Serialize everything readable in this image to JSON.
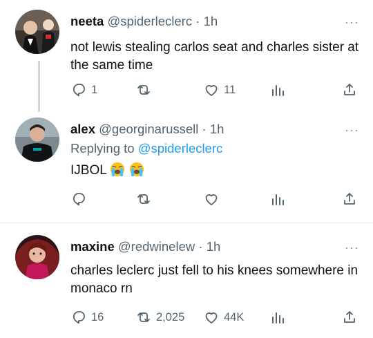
{
  "tweets": [
    {
      "name": "neeta",
      "handle": "@spiderleclerc",
      "separator": "·",
      "time": "1h",
      "more": "···",
      "text": "not lewis stealing carlos seat and charles sister at the same time",
      "reply_count": "1",
      "retweet_count": "",
      "like_count": "11"
    },
    {
      "name": "alex",
      "handle": "@georginarussell",
      "separator": "·",
      "time": "1h",
      "more": "···",
      "replying_prefix": "Replying to",
      "replying_handle": "@spiderleclerc",
      "text": "IJBOL",
      "emoji": "loudly-crying-face",
      "reply_count": "",
      "retweet_count": "",
      "like_count": ""
    },
    {
      "name": "maxine",
      "handle": "@redwinelew",
      "separator": "·",
      "time": "1h",
      "more": "···",
      "text": "charles leclerc just fell to his knees somewhere in monaco rn",
      "reply_count": "16",
      "retweet_count": "2,025",
      "like_count": "44K"
    }
  ],
  "colors": {
    "text_primary": "#0f1419",
    "text_secondary": "#536471",
    "link": "#1d9bf0",
    "thread_line": "#cfd9de",
    "divider": "#e7ecf0"
  },
  "icons": [
    "reply-icon",
    "retweet-icon",
    "like-icon",
    "views-icon",
    "share-icon",
    "more-icon"
  ]
}
